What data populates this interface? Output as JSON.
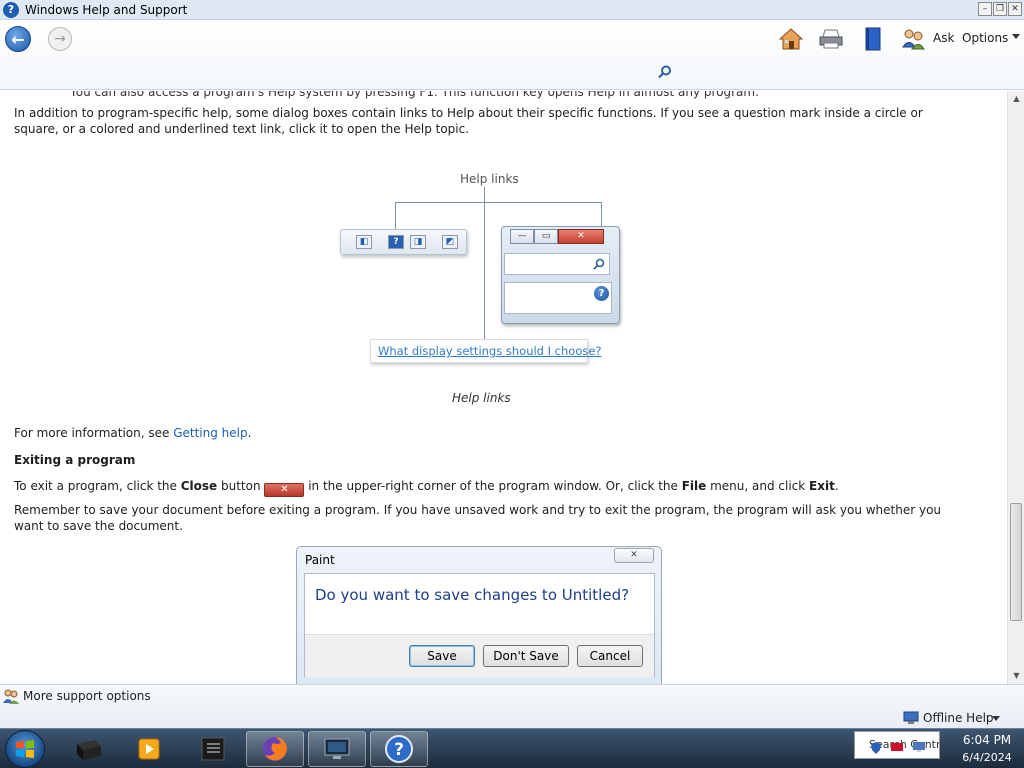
{
  "window": {
    "title": "Windows Help and Support"
  },
  "toolbar": {
    "ask_label": "Ask",
    "options_label": "Options"
  },
  "content": {
    "cut_line": "You can also access a program's Help system by pressing F1. This function key opens Help in almost any program.",
    "para1": "In addition to program-specific help, some dialog boxes contain links to Help about their specific functions. If you see a question mark inside a circle or square, or a colored and underlined text link, click it to open the Help topic.",
    "diagram": {
      "label": "Help links",
      "link_text": "What display settings should I choose?",
      "caption": "Help links"
    },
    "more_info": {
      "before": "For more information, see ",
      "link": "Getting help",
      "after": "."
    },
    "exit_heading": "Exiting a program",
    "exit_para": {
      "t1": "To exit a program, click the ",
      "b1": "Close",
      "t2": " button ",
      "t3": " in the upper-right corner of the program window. Or, click the ",
      "b2": "File",
      "t4": " menu, and click ",
      "b3": "Exit",
      "t5": "."
    },
    "remember_para": "Remember to save your document before exiting a program. If you have unsaved work and try to exit the program, the program will ask you whether you want to save the document.",
    "dialog": {
      "title": "Paint",
      "question": "Do you want to save changes to Untitled?",
      "save": "Save",
      "dont_save": "Don't Save",
      "cancel": "Cancel"
    }
  },
  "statusbar": {
    "support_label": "More support options",
    "offline_label": "Offline Help"
  },
  "taskbar": {
    "tray_popup": "Search Control",
    "time": "6:04 PM",
    "date": "6/4/2024"
  }
}
